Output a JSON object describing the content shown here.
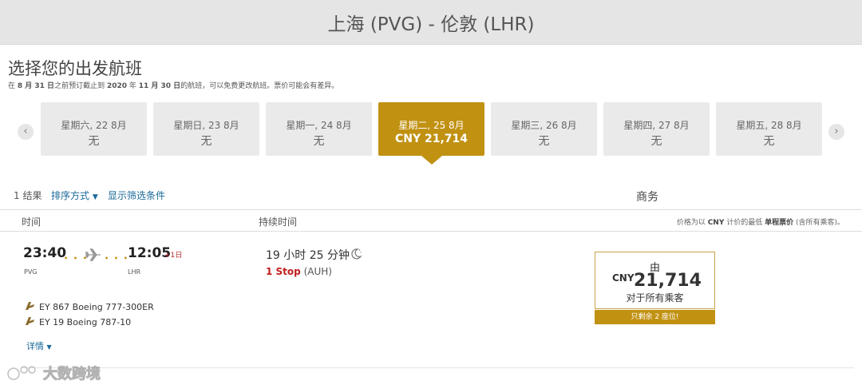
{
  "header": {
    "route_title": "上海 (PVG) - 伦敦 (LHR)"
  },
  "page": {
    "title": "选择您的出发航班",
    "note_parts": [
      "在 ",
      "8 月 31 日",
      "之前预订截止到 ",
      "2020",
      " 年 ",
      "11 月 30 日",
      "的航班，可以免费更改航班。票价可能会有差异。"
    ]
  },
  "nav": {
    "prev_icon": "chevron-left-icon",
    "next_icon": "chevron-right-icon",
    "prev_glyph": "‹",
    "next_glyph": "›"
  },
  "dates": [
    {
      "label": "星期六, 22 8月",
      "price": "无",
      "selected": false
    },
    {
      "label": "星期日, 23 8月",
      "price": "无",
      "selected": false
    },
    {
      "label": "星期一, 24 8月",
      "price": "无",
      "selected": false
    },
    {
      "label": "星期二, 25 8月",
      "price": "CNY 21,714",
      "selected": true
    },
    {
      "label": "星期三, 26 8月",
      "price": "无",
      "selected": false
    },
    {
      "label": "星期四, 27 8月",
      "price": "无",
      "selected": false
    },
    {
      "label": "星期五, 28 8月",
      "price": "无",
      "selected": false
    }
  ],
  "results": {
    "count": "1 结果",
    "sort_label": "排序方式",
    "sort_caret": "▼",
    "filter_label": "显示筛选条件",
    "cabin": "商务"
  },
  "columns": {
    "time": "时间",
    "duration": "持续时间",
    "price_note_parts": [
      "价格为以 ",
      "CNY",
      " 计价的最低 ",
      "单程票价",
      " (含所有乘客)。"
    ]
  },
  "flight": {
    "depart_time": "23:40",
    "depart_code": "PVG",
    "arrive_time": "12:05",
    "arrive_code": "LHR",
    "plus_day": "+1日",
    "dots": "• • •",
    "duration": "19 小时 25 分钟",
    "stops": "1 Stop",
    "stop_via": "(AUH)",
    "segments": [
      {
        "text": "EY 867 Boeing 777-300ER"
      },
      {
        "text": "EY 19 Boeing 787-10"
      }
    ],
    "details_label": "详情",
    "details_caret": "▼"
  },
  "fare": {
    "from_label": "由",
    "currency": "CNY",
    "amount": "21,714",
    "chevron": "⌄",
    "pax_label": "对于所有乘客",
    "seats_left": "只剩余 2 座位!"
  },
  "watermark": {
    "text": "大数跨境"
  },
  "colors": {
    "accent_gold": "#c19112",
    "link_blue": "#1a6a9a",
    "stop_red": "#c11d1d"
  }
}
